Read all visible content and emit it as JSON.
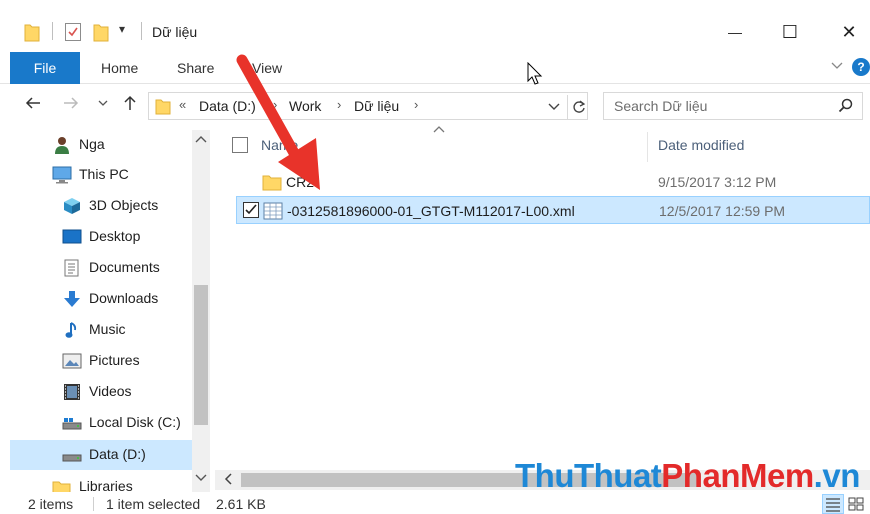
{
  "window": {
    "title": "Dữ liệu",
    "minimize_glyph": "—",
    "maximize_glyph": "☐",
    "close_glyph": "✕"
  },
  "quick_access": {
    "dropdown_glyph": "▾"
  },
  "ribbon": {
    "tabs": [
      "File",
      "Home",
      "Share",
      "View"
    ],
    "help_glyph": "?"
  },
  "address": {
    "overflow": "«",
    "crumbs": [
      "Data (D:)",
      "Work",
      "Dữ liệu"
    ],
    "separator": "›"
  },
  "search": {
    "placeholder": "Search Dữ liệu"
  },
  "nav_pane": {
    "items": [
      {
        "label": "Nga",
        "icon": "user-icon"
      },
      {
        "label": "This PC",
        "icon": "computer-icon"
      },
      {
        "label": "3D Objects",
        "icon": "cube-icon"
      },
      {
        "label": "Desktop",
        "icon": "desktop-icon"
      },
      {
        "label": "Documents",
        "icon": "documents-icon"
      },
      {
        "label": "Downloads",
        "icon": "download-icon"
      },
      {
        "label": "Music",
        "icon": "music-icon"
      },
      {
        "label": "Pictures",
        "icon": "pictures-icon"
      },
      {
        "label": "Videos",
        "icon": "video-icon"
      },
      {
        "label": "Local Disk (C:)",
        "icon": "drive-icon"
      },
      {
        "label": "Data (D:)",
        "icon": "drive-icon",
        "selected": true
      },
      {
        "label": "Libraries",
        "icon": "library-icon"
      }
    ]
  },
  "file_list": {
    "columns": {
      "name": "Name",
      "date": "Date modified"
    },
    "rows": [
      {
        "name": "CR2",
        "date": "9/15/2017 3:12 PM",
        "type": "folder",
        "selected": false
      },
      {
        "name": "-0312581896000-01_GTGT-M112017-L00.xml",
        "date": "12/5/2017 12:59 PM",
        "type": "xml",
        "selected": true
      }
    ]
  },
  "status": {
    "count": "2 items",
    "selection": "1 item selected",
    "size": "2.61 KB"
  },
  "watermark": {
    "part1": "ThuThuat",
    "part2": "PhanMem",
    "part3": ".vn"
  },
  "colors": {
    "accent": "#1979ca",
    "selection": "#cce8ff",
    "arrow": "#e8332a",
    "folder": "#ffd766"
  }
}
